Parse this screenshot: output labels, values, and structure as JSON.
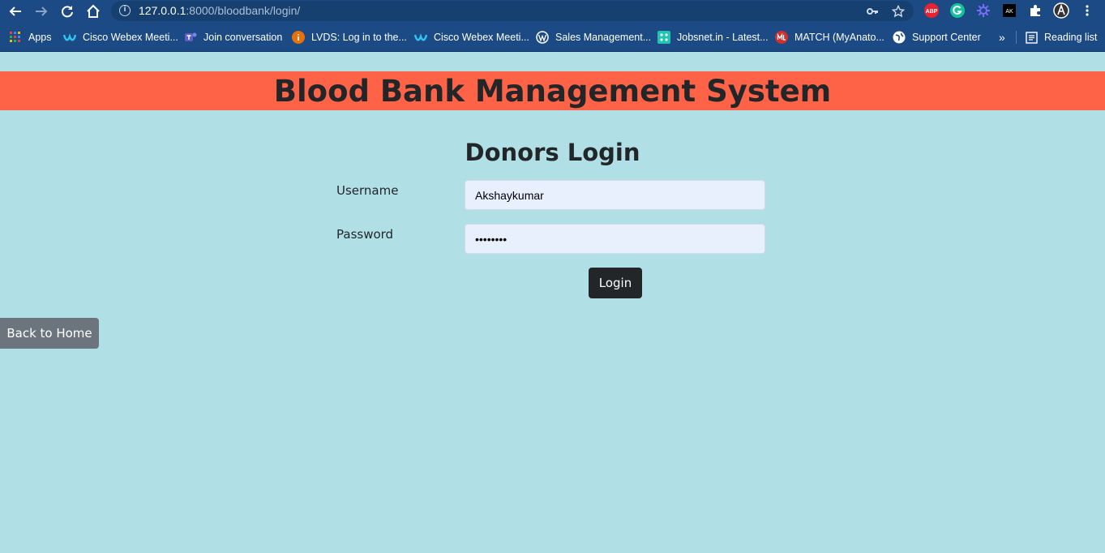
{
  "browser": {
    "url_host": "127.0.0.1",
    "url_path": ":8000/bloodbank/login/",
    "bookmarks": [
      {
        "label": "Apps"
      },
      {
        "label": "Cisco Webex Meeti..."
      },
      {
        "label": "Join conversation"
      },
      {
        "label": "LVDS: Log in to the..."
      },
      {
        "label": "Cisco Webex Meeti..."
      },
      {
        "label": "Sales Management..."
      },
      {
        "label": "Jobsnet.in - Latest..."
      },
      {
        "label": "MATCH (MyAnato..."
      },
      {
        "label": "Support Center"
      }
    ],
    "more_label": "»",
    "reading_list_label": "Reading list",
    "ext_abp_label": "ABP",
    "ext_ak_label": "AK"
  },
  "page": {
    "banner_title": "Blood Bank Management System",
    "login_heading": "Donors Login",
    "username_label": "Username",
    "username_value": "Akshaykumar",
    "password_label": "Password",
    "password_value": "akshayk1",
    "login_button": "Login",
    "back_home_button": "Back to Home"
  },
  "colors": {
    "page_background": "#b0e0e6",
    "banner": "#ff6347",
    "login_button": "#222629",
    "home_button": "#6c757d",
    "input_fill": "#e8f0fe"
  }
}
